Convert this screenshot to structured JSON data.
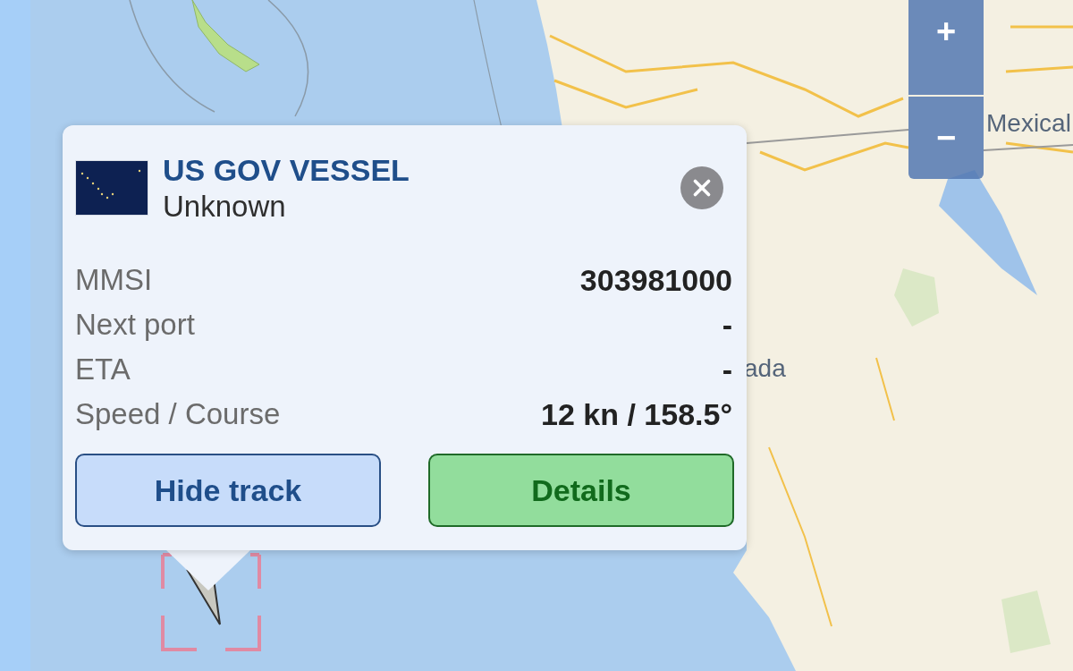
{
  "map": {
    "labels": [
      {
        "text": "Mexical"
      },
      {
        "text": "ada"
      }
    ]
  },
  "zoom_controls": [
    {
      "label": "+"
    },
    {
      "label": "−"
    }
  ],
  "vessel_popup": {
    "name": "US GOV VESSEL",
    "type": "Unknown",
    "rows": [
      {
        "label": "MMSI",
        "value": "303981000"
      },
      {
        "label": "Next port",
        "value": "-"
      },
      {
        "label": "ETA",
        "value": "-"
      },
      {
        "label": "Speed / Course",
        "value": "12 kn / 158.5°"
      }
    ],
    "buttons": [
      {
        "label": "Hide track",
        "kind": "secondary"
      },
      {
        "label": "Details",
        "kind": "primary"
      }
    ]
  }
}
